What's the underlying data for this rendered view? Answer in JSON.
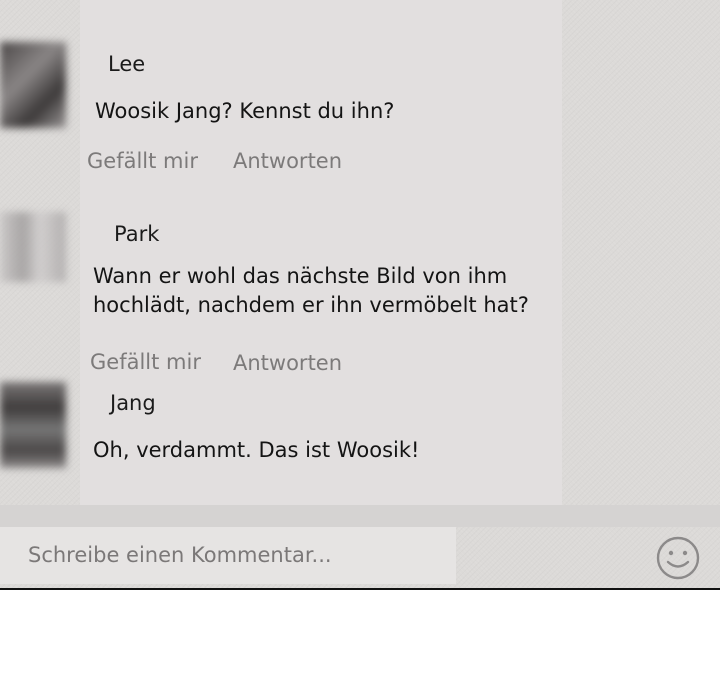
{
  "comments": [
    {
      "author": "Lee",
      "text": "Woosik Jang? Kennst du ihn?",
      "like_label": "Gefällt mir",
      "reply_label": "Antworten"
    },
    {
      "author": "Park",
      "text_line1": "Wann er wohl das nächste Bild von ihm",
      "text_line2": "hochlädt, nachdem er ihn vermöbelt hat?",
      "like_label": "Gefällt mir",
      "reply_label": "Antworten"
    },
    {
      "author": "Jang",
      "text": "Oh, verdammt. Das ist Woosik!"
    }
  ],
  "comment_input": {
    "placeholder": "Schreibe einen Kommentar...",
    "value": ""
  },
  "emoji_button": {
    "icon": "smiley-icon"
  }
}
